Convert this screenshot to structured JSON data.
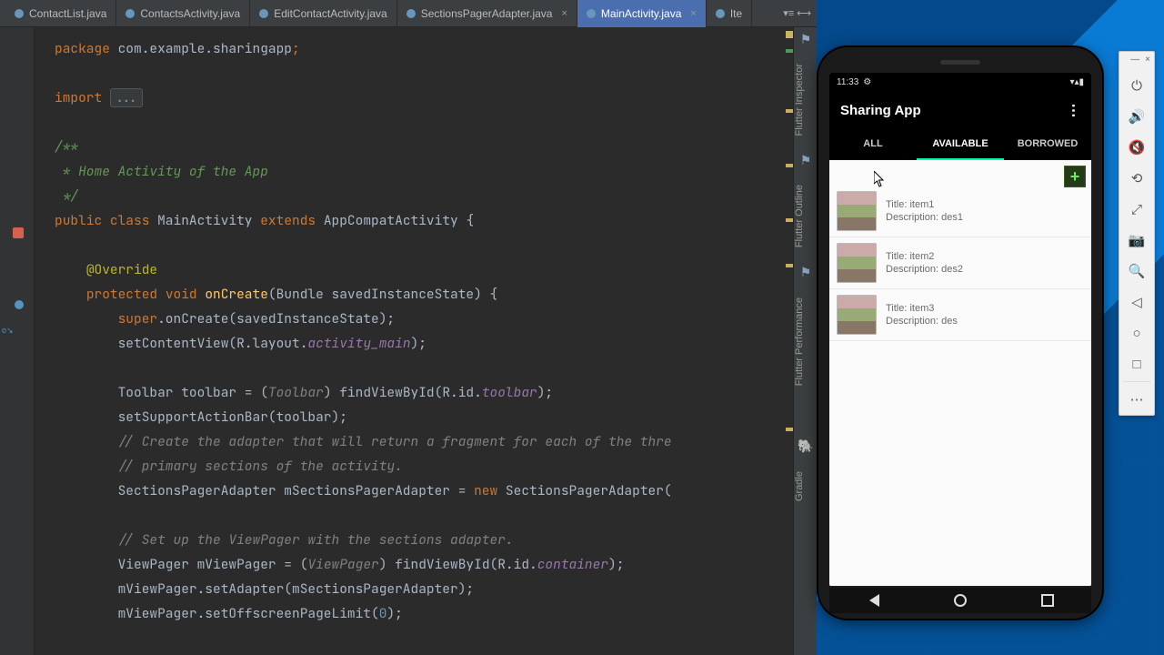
{
  "tabs": [
    {
      "label": "ContactList.java",
      "active": false
    },
    {
      "label": "ContactsActivity.java",
      "active": false
    },
    {
      "label": "EditContactActivity.java",
      "active": false
    },
    {
      "label": "SectionsPagerAdapter.java",
      "active": false
    },
    {
      "label": "MainActivity.java",
      "active": true
    },
    {
      "label": "Ite",
      "active": false
    }
  ],
  "side_tools": [
    "Flutter Inspector",
    "Flutter Outline",
    "Flutter Performance",
    "Gradle"
  ],
  "code": {
    "pkg_kw": "package ",
    "pkg_val": "com.example.sharingapp",
    "import_kw": "import ",
    "import_dots": "...",
    "doc1": "/**",
    "doc2": " * Home Activity of the App",
    "doc3": " */",
    "pub": "public ",
    "cls_kw": "class ",
    "cls_name": "MainActivity ",
    "ext": "extends ",
    "sup": "AppCompatActivity ",
    "ann": "@Override",
    "prot": "protected ",
    "void": "void ",
    "onCreate": "onCreate",
    "onCreate_sig": "(Bundle savedInstanceState) {",
    "super1": "super",
    "super2": ".onCreate(savedInstanceState);",
    "scv1": "setContentView(R.layout.",
    "scv2": "activity_main",
    "scv3": ");",
    "tb1": "Toolbar toolbar = (",
    "tb_cast": "Toolbar",
    "tb2": ") findViewById(R.id.",
    "tb_fld": "toolbar",
    "tb3": ");",
    "ssa": "setSupportActionBar(toolbar);",
    "c1": "// Create the adapter that will return a fragment for each of the thre",
    "c2": "// primary sections of the activity.",
    "spa1": "SectionsPagerAdapter mSectionsPagerAdapter = ",
    "new": "new ",
    "spa2": "SectionsPagerAdapter(",
    "c3": "// Set up the ViewPager with the sections adapter.",
    "vp1": "ViewPager mViewPager = (",
    "vp_cast": "ViewPager",
    "vp2": ") findViewById(R.id.",
    "vp_fld": "container",
    "vp3": ");",
    "vp4": "mViewPager.setAdapter(mSectionsPagerAdapter);",
    "vp5": "mViewPager.setOffscreenPageLimit(",
    "zero": "0",
    "vp6": ");"
  },
  "phone": {
    "time": "11:33",
    "app_title": "Sharing App",
    "tabs": [
      "ALL",
      "AVAILABLE",
      "BORROWED"
    ],
    "active_tab": 1,
    "items": [
      {
        "title": "Title: item1",
        "desc": "Description: des1"
      },
      {
        "title": "Title: item2",
        "desc": "Description: des2"
      },
      {
        "title": "Title: item3",
        "desc": "Description: des"
      }
    ]
  },
  "emu_buttons": [
    "⏻",
    "🔊",
    "🔇",
    "⟲",
    "⤢",
    "📷",
    "🔍",
    "◁",
    "○",
    "□",
    "⋯"
  ]
}
